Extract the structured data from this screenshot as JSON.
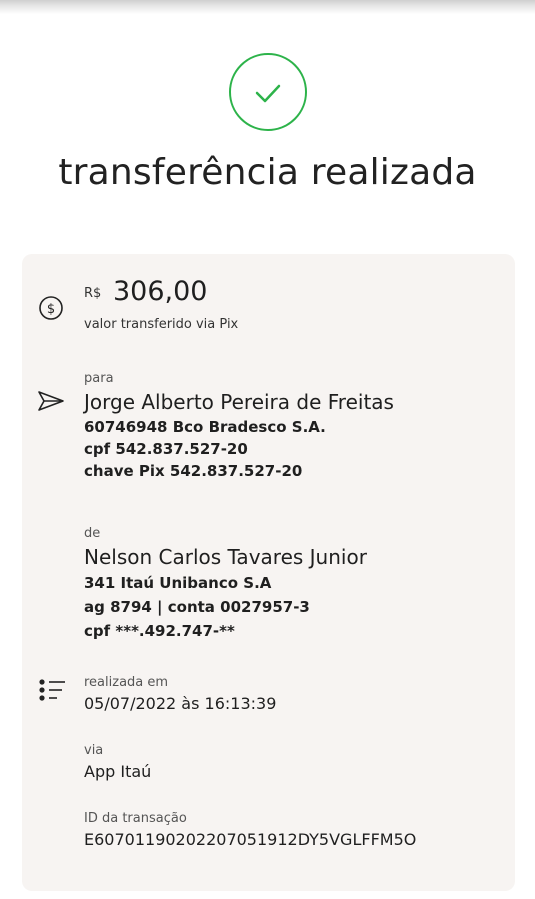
{
  "status": {
    "icon": "check-icon",
    "title": "transferência realizada",
    "accent_color": "#2db34a"
  },
  "amount": {
    "currency": "R$",
    "value": "306,00",
    "label": "valor transferido via Pix",
    "icon": "dollar-circle-icon"
  },
  "recipient": {
    "label": "para",
    "icon": "send-icon",
    "name": "Jorge Alberto Pereira de Freitas",
    "bank": "60746948 Bco Bradesco S.A.",
    "cpf": "cpf 542.837.527-20",
    "pix_key": "chave Pix 542.837.527-20"
  },
  "sender": {
    "label": "de",
    "name": "Nelson Carlos Tavares Junior",
    "bank": "341 Itaú Unibanco S.A",
    "account": "ag 8794 | conta 0027957-3",
    "cpf": "cpf ***.492.747-**"
  },
  "details": {
    "icon": "list-icon",
    "date_label": "realizada em",
    "date_value": "05/07/2022 às 16:13:39",
    "via_label": "via",
    "via_value": "App Itaú",
    "id_label": "ID da transação",
    "id_value": "E60701190202207051912DY5VGLFFM5O"
  }
}
